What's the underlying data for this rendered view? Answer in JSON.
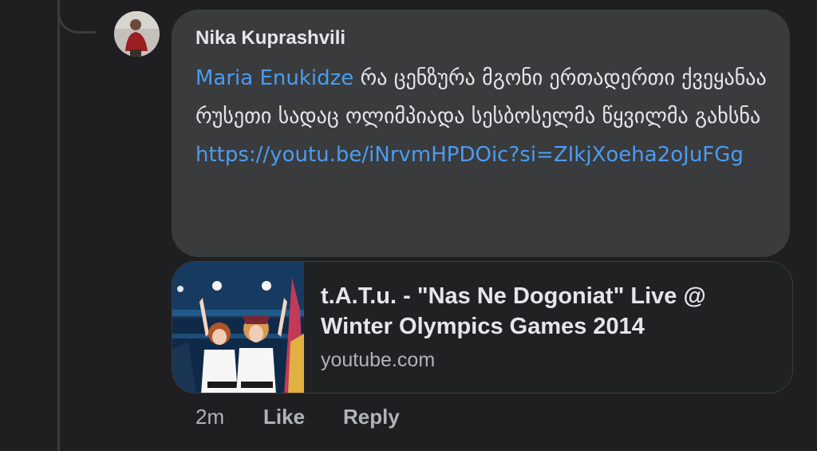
{
  "comment": {
    "author": "Nika Kuprashvili",
    "mention": "Maria Enukidze",
    "body": " რა ცენზურა მგონი ერთადერთი ქვეყანაა რუსეთი სადაც ოლიმპიადა სესბოსელმა წყვილმა გახსნა",
    "link": "https://youtu.be/iNrvmHPDOic?si=ZIkjXoeha2oJuFGg"
  },
  "link_preview": {
    "title": "t.A.T.u. - \"Nas Ne Dogoniat\" Live @ Winter Olympics Games 2014",
    "domain": "youtube.com",
    "thumbnail": "video-thumbnail"
  },
  "actions": {
    "timestamp": "2m",
    "like_label": "Like",
    "reply_label": "Reply"
  },
  "colors": {
    "background": "#1f1f21",
    "bubble": "#3a3b3c",
    "link": "#4b9cf2",
    "text": "#e4e6eb",
    "muted": "#b0b3b8"
  }
}
